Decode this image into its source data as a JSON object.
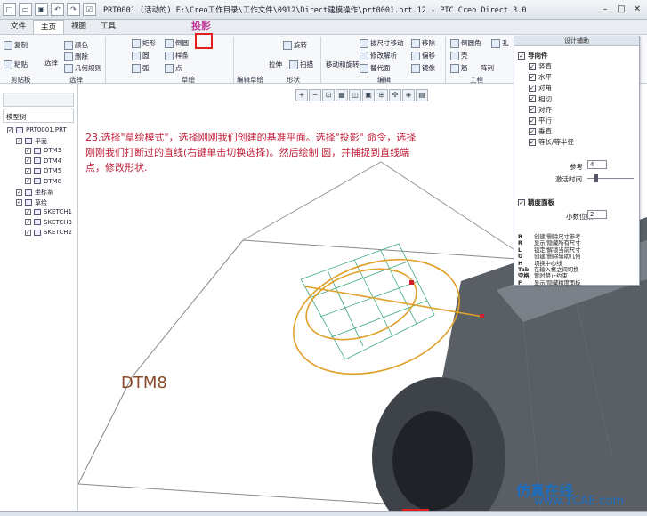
{
  "window": {
    "title": "PRT0001 (活动的) E:\\Creo工作目录\\工作文件\\0912\\Direct建模操作\\prt0001.prt.12 - PTC Creo Direct 3.0"
  },
  "menu": {
    "tabs": [
      "文件",
      "主页",
      "视图",
      "工具"
    ],
    "active": 1
  },
  "ribbon": {
    "items": [
      {
        "id": "copy",
        "label": "复制"
      },
      {
        "id": "color",
        "label": "颜色"
      },
      {
        "id": "paste",
        "label": "粘贴"
      },
      {
        "id": "delete",
        "label": "删除"
      },
      {
        "id": "select",
        "label": "选择"
      },
      {
        "id": "geom_style",
        "label": "几何规则"
      },
      {
        "id": "rect",
        "label": "矩形"
      },
      {
        "id": "circle",
        "label": "圆"
      },
      {
        "id": "arc",
        "label": "弧"
      },
      {
        "id": "spline",
        "label": "样条"
      },
      {
        "id": "chamfer",
        "label": "倒圆"
      },
      {
        "id": "point",
        "label": "点"
      },
      {
        "id": "rotate",
        "label": "旋转"
      },
      {
        "id": "extrude",
        "label": "拉伸"
      },
      {
        "id": "sweep",
        "label": "扫描"
      },
      {
        "id": "move_rotate",
        "label": "移动和旋转"
      },
      {
        "id": "pull",
        "label": "拔尺寸移动"
      },
      {
        "id": "modify",
        "label": "修改解析"
      },
      {
        "id": "replace",
        "label": "替代面"
      },
      {
        "id": "offset_face",
        "label": "移除"
      },
      {
        "id": "offset",
        "label": "偏移"
      },
      {
        "id": "mirror",
        "label": "镜像"
      },
      {
        "id": "round",
        "label": "倒圆角"
      },
      {
        "id": "shell",
        "label": "壳"
      },
      {
        "id": "rib",
        "label": "筋"
      },
      {
        "id": "array",
        "label": "阵列"
      },
      {
        "id": "hole",
        "label": "孔"
      }
    ],
    "groups": [
      "剪贴板",
      "选择",
      "草绘",
      "编辑草绘",
      "形状",
      "编辑",
      "工程"
    ]
  },
  "callout": {
    "label": "投影"
  },
  "tree": {
    "title": "模型树",
    "items": [
      {
        "label": "PRT0001.PRT",
        "lvl": 0
      },
      {
        "label": "平面",
        "lvl": 1
      },
      {
        "label": "DTM3",
        "lvl": 2
      },
      {
        "label": "DTM4",
        "lvl": 2
      },
      {
        "label": "DTM5",
        "lvl": 2
      },
      {
        "label": "DTM8",
        "lvl": 2
      },
      {
        "label": "坐标系",
        "lvl": 1
      },
      {
        "label": "草绘",
        "lvl": 1
      },
      {
        "label": "SKETCH1",
        "lvl": 2
      },
      {
        "label": "SKETCH3",
        "lvl": 2
      },
      {
        "label": "SKETCH2",
        "lvl": 2
      }
    ]
  },
  "instruction": {
    "text": "23.选择\"草绘模式\"，选择刚刚我们创建的基准平面。选择\"投影\" 命令，选择刚刚我们打断过的直线(右键单击切换选择)。然后绘制 圆，并捕捉到直线端点，修改形状."
  },
  "canvas": {
    "datum_label": "DTM8"
  },
  "panel": {
    "title": "设计辅助",
    "constraints_label": "导向件",
    "constraints": [
      "竖直",
      "水平",
      "对角",
      "相切",
      "对齐",
      "平行",
      "垂直",
      "等长/等半径"
    ],
    "params": {
      "snap_label": "参考",
      "snap_value": "4",
      "time_label": "激活时间",
      "display_label": "精度面板",
      "decimal_label": "小数位数",
      "decimal_value": "2"
    },
    "shortcuts": [
      {
        "key": "B",
        "text": "创建/删除尺寸参考"
      },
      {
        "key": "R",
        "text": "显示/隐藏所有尺寸"
      },
      {
        "key": "L",
        "text": "锁定/解锁当前尺寸"
      },
      {
        "key": "G",
        "text": "创建/删除辅助几何"
      },
      {
        "key": "H",
        "text": "切换中心线"
      },
      {
        "key": "Tab",
        "text": "在输入框之间切换"
      },
      {
        "key": "空格",
        "text": "暂时禁止约束"
      },
      {
        "key": "F",
        "text": "显示/隐藏精度面板"
      }
    ]
  },
  "watermark": {
    "line1": "仿真在线",
    "line2": "www.1CAE.com"
  }
}
